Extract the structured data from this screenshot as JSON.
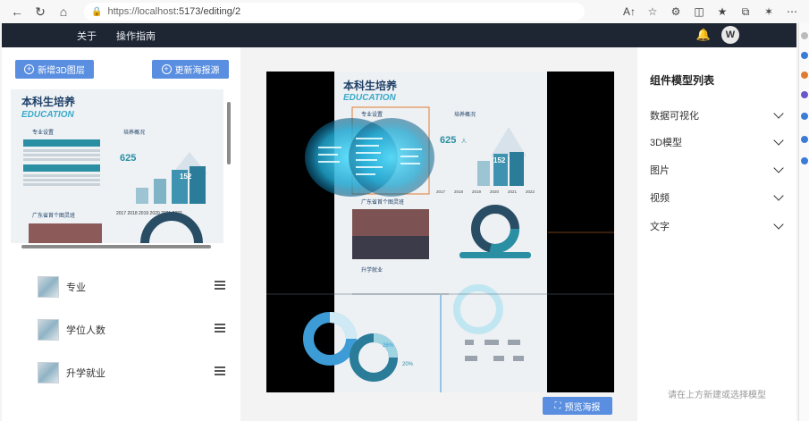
{
  "browser": {
    "url_host": "https://localhost",
    "url_path": ":5173/editing/2",
    "nav_icons": [
      "back-icon",
      "refresh-icon",
      "home-icon"
    ],
    "toolbar_icons": [
      "read-aloud-icon",
      "favorite-icon",
      "extension-icon",
      "split-screen-icon",
      "favorites-bar-icon",
      "collections-icon",
      "shield-icon",
      "more-icon"
    ]
  },
  "header": {
    "menu": [
      "关于",
      "操作指南"
    ],
    "avatar_letter": "W",
    "bg_color": "#1f2633"
  },
  "left_panel": {
    "add_3d_layer": "新增3D图层",
    "update_poster": "更新海报源",
    "layers": [
      {
        "label": "专业"
      },
      {
        "label": "学位人数"
      },
      {
        "label": "升学就业"
      }
    ]
  },
  "poster": {
    "title": "本科生培养",
    "subtitle": "EDUCATION",
    "section_major": "专业设置",
    "section_overview": "培养概况",
    "section_province": "广东省首个图灵班",
    "section_career": "升学就业",
    "big_number": "625",
    "big_number_unit": "人",
    "bar_value": "152",
    "years": [
      "2017",
      "2018",
      "2019",
      "2020",
      "2021",
      "2022"
    ],
    "ring_percent": "26%",
    "ring_percent2": "20%"
  },
  "center": {
    "preview_button": "预览海报"
  },
  "right_panel": {
    "title": "组件模型列表",
    "categories": [
      "数据可视化",
      "3D模型",
      "图片",
      "视频",
      "文字"
    ],
    "hint": "请在上方新建或选择模型"
  },
  "colors": {
    "accent": "#5a8ee0",
    "teal": "#2a8fa3",
    "hologram": "#38c6e8"
  }
}
